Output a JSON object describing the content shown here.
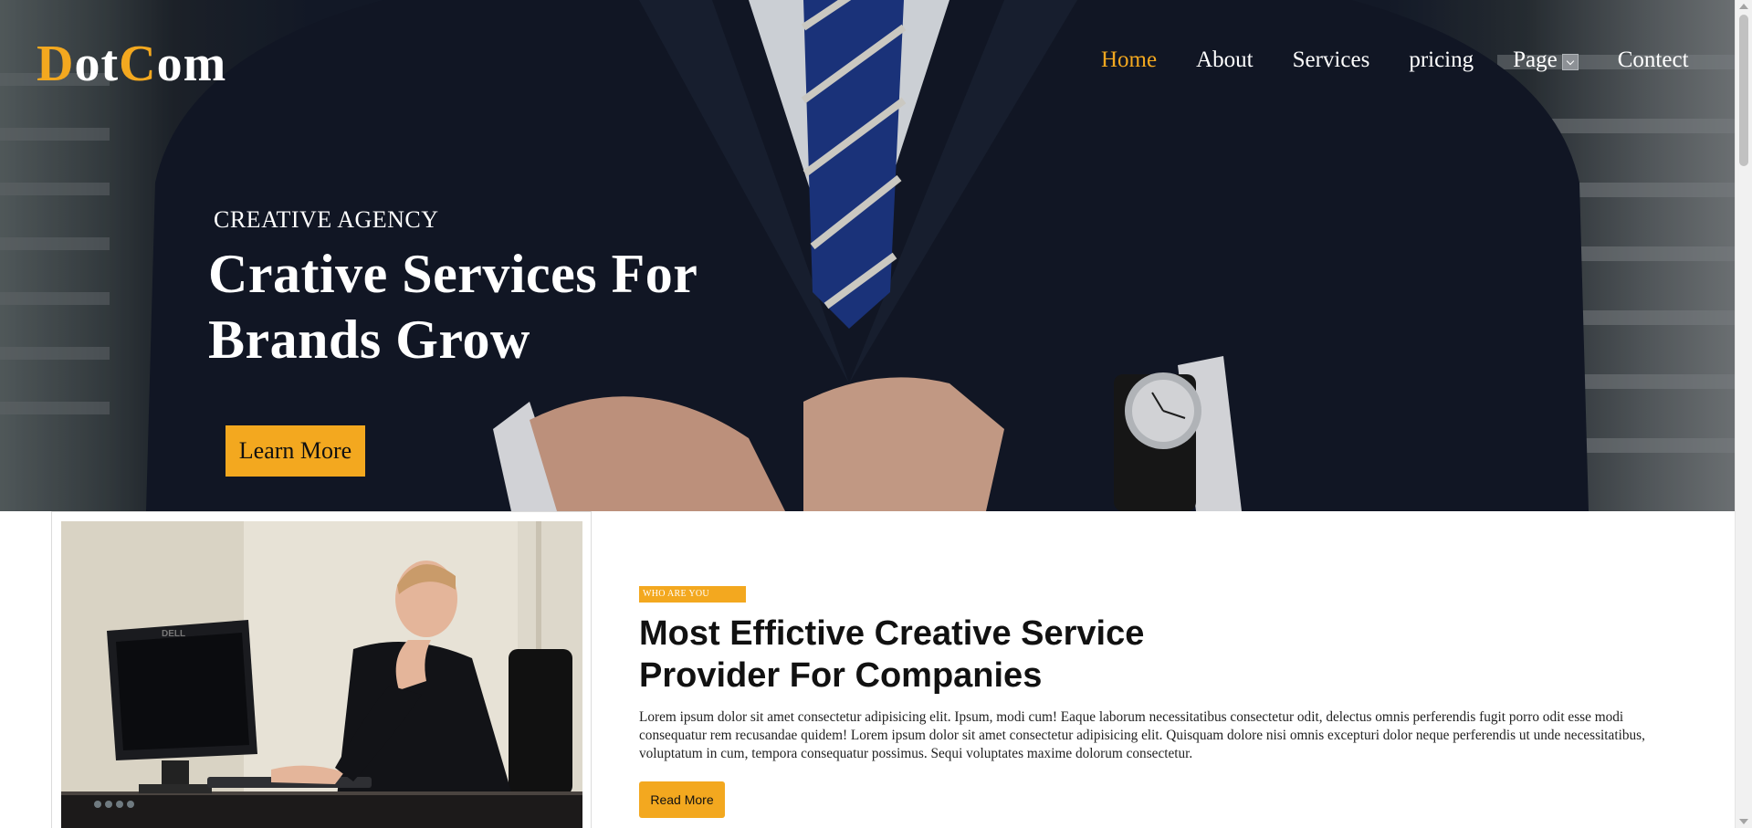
{
  "header": {
    "logo": {
      "part1": "D",
      "part2": "ot",
      "part3": "C",
      "part4": "om"
    },
    "nav": [
      {
        "label": "Home",
        "active": true
      },
      {
        "label": "About"
      },
      {
        "label": "Services"
      },
      {
        "label": "pricing"
      },
      {
        "label": "Page",
        "has_dropdown": true
      },
      {
        "label": "Contect"
      }
    ]
  },
  "hero": {
    "eyebrow": "CREATIVE AGENCY",
    "headline_line1": "Crative Services For",
    "headline_line2": "Brands Grow",
    "cta": "Learn More"
  },
  "about": {
    "tag": "WHO ARE YOU",
    "title_line1": "Most Effictive Creative Service",
    "title_line2": "Provider For Companies",
    "body": "Lorem ipsum dolor sit amet consectetur adipisicing elit. Ipsum, modi cum! Eaque laborum necessitatibus consectetur odit, delectus omnis perferendis fugit porro odit esse modi consequatur rem recusandae quidem! Lorem ipsum dolor sit amet consectetur adipisicing elit. Quisquam dolore nisi omnis excepturi dolor neque perferendis ut unde necessitatibus, voluptatum in cum, tempora consequatur possimus. Sequi voluptates maxime dolorum consectetur.",
    "cta": "Read More",
    "photo_monitor_brand": "DELL"
  },
  "colors": {
    "accent": "#f3a81f",
    "hero_suit": "#151c2c",
    "text_dark": "#111111"
  }
}
